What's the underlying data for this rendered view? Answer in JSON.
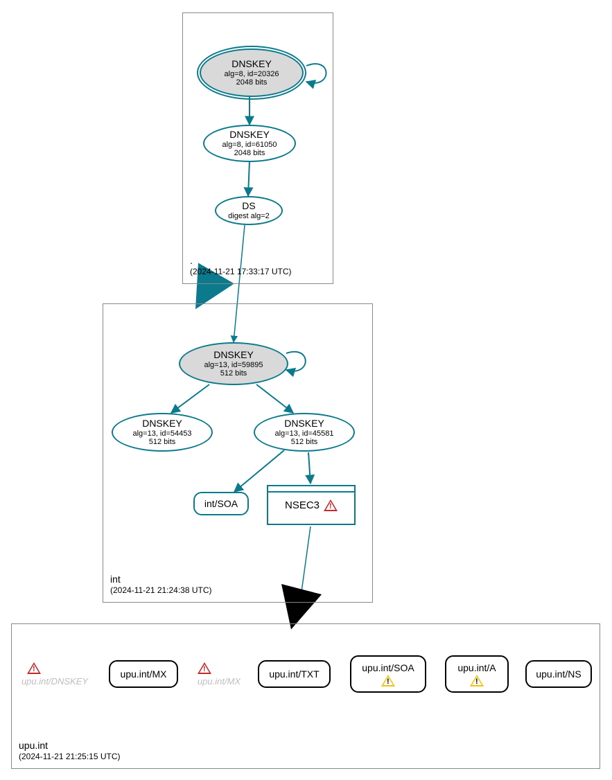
{
  "zones": {
    "root": {
      "name": ".",
      "timestamp": "(2024-11-21 17:33:17 UTC)"
    },
    "int": {
      "name": "int",
      "timestamp": "(2024-11-21 21:24:38 UTC)"
    },
    "upu": {
      "name": "upu.int",
      "timestamp": "(2024-11-21 21:25:15 UTC)"
    }
  },
  "nodes": {
    "root_ksk": {
      "title": "DNSKEY",
      "line1": "alg=8, id=20326",
      "line2": "2048 bits"
    },
    "root_zsk": {
      "title": "DNSKEY",
      "line1": "alg=8, id=61050",
      "line2": "2048 bits"
    },
    "root_ds": {
      "title": "DS",
      "line1": "digest alg=2"
    },
    "int_ksk": {
      "title": "DNSKEY",
      "line1": "alg=13, id=59895",
      "line2": "512 bits"
    },
    "int_zsk_a": {
      "title": "DNSKEY",
      "line1": "alg=13, id=54453",
      "line2": "512 bits"
    },
    "int_zsk_b": {
      "title": "DNSKEY",
      "line1": "alg=13, id=45581",
      "line2": "512 bits"
    },
    "int_soa": {
      "label": "int/SOA"
    },
    "int_nsec3": {
      "label": "NSEC3"
    },
    "upu_dnskey_ghost": {
      "label": "upu.int/DNSKEY"
    },
    "upu_mx": {
      "label": "upu.int/MX"
    },
    "upu_mx_ghost": {
      "label": "upu.int/MX"
    },
    "upu_txt": {
      "label": "upu.int/TXT"
    },
    "upu_soa": {
      "label": "upu.int/SOA"
    },
    "upu_a": {
      "label": "upu.int/A"
    },
    "upu_ns": {
      "label": "upu.int/NS"
    }
  },
  "colors": {
    "teal": "#0a7a8c",
    "grey": "#d9d9d9"
  }
}
